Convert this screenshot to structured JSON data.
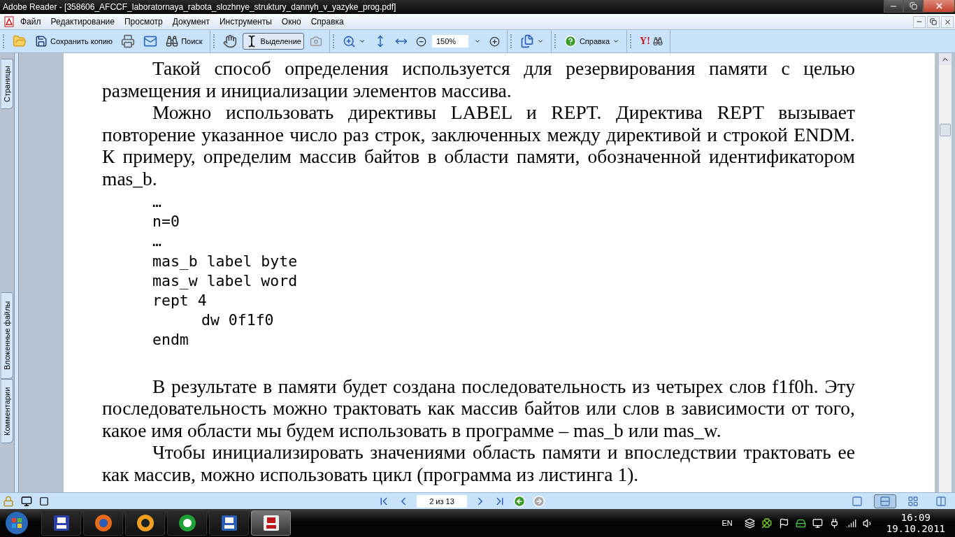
{
  "window": {
    "title": "Adobe Reader - [358606_AFCCF_laboratornaya_rabota_slozhnye_struktury_dannyh_v_yazyke_prog.pdf]"
  },
  "menu": [
    "Файл",
    "Редактирование",
    "Просмотр",
    "Документ",
    "Инструменты",
    "Окно",
    "Справка"
  ],
  "toolbar": {
    "save_label": "Сохранить копию",
    "search_label": "Поиск",
    "tools": [
      {
        "kind": "hand",
        "selected": false
      },
      {
        "kind": "select",
        "label": "Выделение",
        "selected": true
      }
    ],
    "zoom": "150%",
    "help_label": "Справка",
    "yahoo_logo": "Y!"
  },
  "side_tabs": [
    {
      "label": "Страницы"
    },
    {
      "label": "Вложенные файлы"
    },
    {
      "label": "Комментарии"
    }
  ],
  "document": {
    "blocks": [
      {
        "kind": "para",
        "text": "Такой способ определения используется для резервирования памяти с целью размещения и инициализации элементов массива."
      },
      {
        "kind": "para",
        "text": "Можно использовать директивы LABEL и REPT. Директива REPT вызывает повторение указанное число раз строк, заключенных между директивой и строкой ENDM. К примеру, определим массив байтов в области памяти, обозначенной идентификатором mas_b."
      },
      {
        "kind": "code",
        "lines": [
          {
            "text": "…",
            "indented": false
          },
          {
            "text": "n=0",
            "indented": false
          },
          {
            "text": "…",
            "indented": false
          },
          {
            "text": "mas_b label byte",
            "indented": false
          },
          {
            "text": "mas_w label word",
            "indented": false
          },
          {
            "text": "rept 4",
            "indented": false
          },
          {
            "text": "dw 0f1f0",
            "indented": true
          },
          {
            "text": "endm",
            "indented": false
          }
        ]
      },
      {
        "kind": "para",
        "text": "В результате в памяти будет создана последовательность из четырех слов f1f0h. Эту последовательность можно трактовать как массив байтов или слов в зависимости от того, какое имя области мы будем использовать в программе – mas_b или mas_w."
      },
      {
        "kind": "para",
        "text": "Чтобы инициализировать значениями область памяти и впоследствии трактовать ее как массив, можно использовать цикл (программа из листинга 1)."
      }
    ]
  },
  "status": {
    "page": "2 из 13",
    "views": [
      {
        "kind": "single",
        "selected": false
      },
      {
        "kind": "continuous",
        "selected": true
      },
      {
        "kind": "facing-continuous",
        "selected": false
      },
      {
        "kind": "facing",
        "selected": false
      }
    ]
  },
  "taskbar": {
    "apps": [
      {
        "kind": "floppy",
        "selected": false
      },
      {
        "kind": "firefox",
        "selected": false
      },
      {
        "kind": "aimp",
        "selected": false
      },
      {
        "kind": "utorrent",
        "selected": false
      },
      {
        "kind": "word",
        "selected": false
      },
      {
        "kind": "acrobat",
        "selected": true
      }
    ],
    "language": "EN",
    "time": "16:09",
    "date": "19.10.2011"
  }
}
